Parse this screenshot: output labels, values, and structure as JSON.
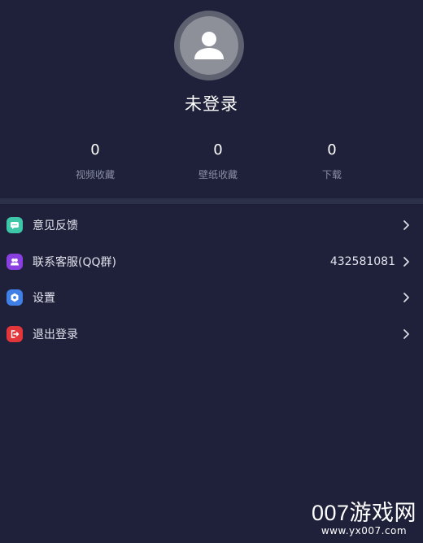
{
  "profile": {
    "avatar_icon": "user-avatar-icon",
    "username": "未登录"
  },
  "stats": [
    {
      "value": "0",
      "label": "视频收藏"
    },
    {
      "value": "0",
      "label": "壁纸收藏"
    },
    {
      "value": "0",
      "label": "下载"
    }
  ],
  "menu": {
    "items": [
      {
        "label": "意见反馈",
        "value": "",
        "icon": "feedback-icon",
        "color": "#3ec6a8"
      },
      {
        "label": "联系客服(QQ群)",
        "value": "432581081",
        "icon": "contact-service-icon",
        "color": "#8a3fe0"
      },
      {
        "label": "设置",
        "value": "",
        "icon": "settings-icon",
        "color": "#3f7fe6"
      },
      {
        "label": "退出登录",
        "value": "",
        "icon": "logout-icon",
        "color": "#e2363a"
      }
    ]
  },
  "watermark": {
    "main": "007游戏网",
    "sub": "www.yx007.com"
  },
  "colors": {
    "background": "#1e2139",
    "divider": "#2c3049"
  }
}
